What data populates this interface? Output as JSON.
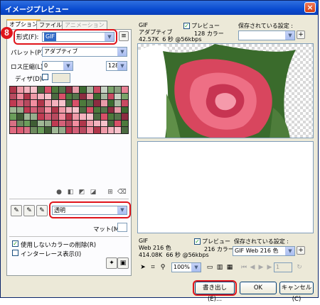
{
  "window": {
    "title": "イメージプレビュー",
    "close_glyph": "×"
  },
  "badge": {
    "number": "8"
  },
  "tabs": [
    {
      "label": "オプション",
      "active": true
    },
    {
      "label": "ファイル",
      "active": false
    },
    {
      "label": "アニメーション",
      "active": false,
      "disabled": true
    }
  ],
  "options": {
    "format_label": "形式(F):",
    "format_value": "GIF",
    "palette_label": "パレット(P):",
    "palette_value": "アダプティブ",
    "loss_label": "ロス圧縮(L):",
    "loss_value": "0",
    "colors_value": "128",
    "dither_label": "ディザ(D):",
    "transparency_value": "透明",
    "matte_label": "マット(M):",
    "remove_unused_label": "使用しないカラーの削除(R)",
    "interlace_label": "インターレース表示(I)",
    "remove_unused_checked": true,
    "interlace_checked": false
  },
  "preview_top": {
    "format": "GIF",
    "palette": "アダプティブ",
    "stats": "42.57K  6 秒 @56kbps",
    "preview_label": "プレビュー",
    "preview_checked": true,
    "colors": "128 カラー",
    "saved_settings_label": "保存されている設定 :",
    "saved_settings_value": ""
  },
  "preview_bottom": {
    "format": "GIF",
    "palette": "Web 216 色",
    "stats": "414.08K  66 秒 @56kbps",
    "preview_label": "プレビュー",
    "preview_checked": true,
    "colors": "216 カラー",
    "saved_settings_label": "保存されている設定 :",
    "saved_settings_value": "GIF Web 216 色"
  },
  "toolbar": {
    "zoom_value": "100%",
    "frame_value": "1"
  },
  "buttons": {
    "export": "書き出し(E)...",
    "ok": "OK",
    "cancel": "キャンセル(C)"
  },
  "swatch_colors": [
    "#b0364a",
    "#d85068",
    "#3d6b31",
    "#8aa080",
    "#e07486",
    "#6d8a5e",
    "#c03a52",
    "#f09aa8",
    "#4d7a3c",
    "#a9b9a2",
    "#e88094",
    "#90284a",
    "#6b9e5b",
    "#d46078",
    "#f4b2be",
    "#55754b",
    "#c94a62",
    "#7e9a73",
    "#e06a80",
    "#3f5d34",
    "#b84a5f",
    "#f7c2cb",
    "#8c2c40",
    "#c8d2c4",
    "#5f8a50",
    "#dc5a72",
    "#a0b896",
    "#f28ea0",
    "#4b6b41",
    "#e89aa8",
    "#7aa46a",
    "#b33850",
    "#d87084",
    "#96ac8c"
  ],
  "colors": {
    "accent_red": "#e0131a",
    "title_blue": "#0a4bd0",
    "selection_blue": "#316ac5"
  }
}
